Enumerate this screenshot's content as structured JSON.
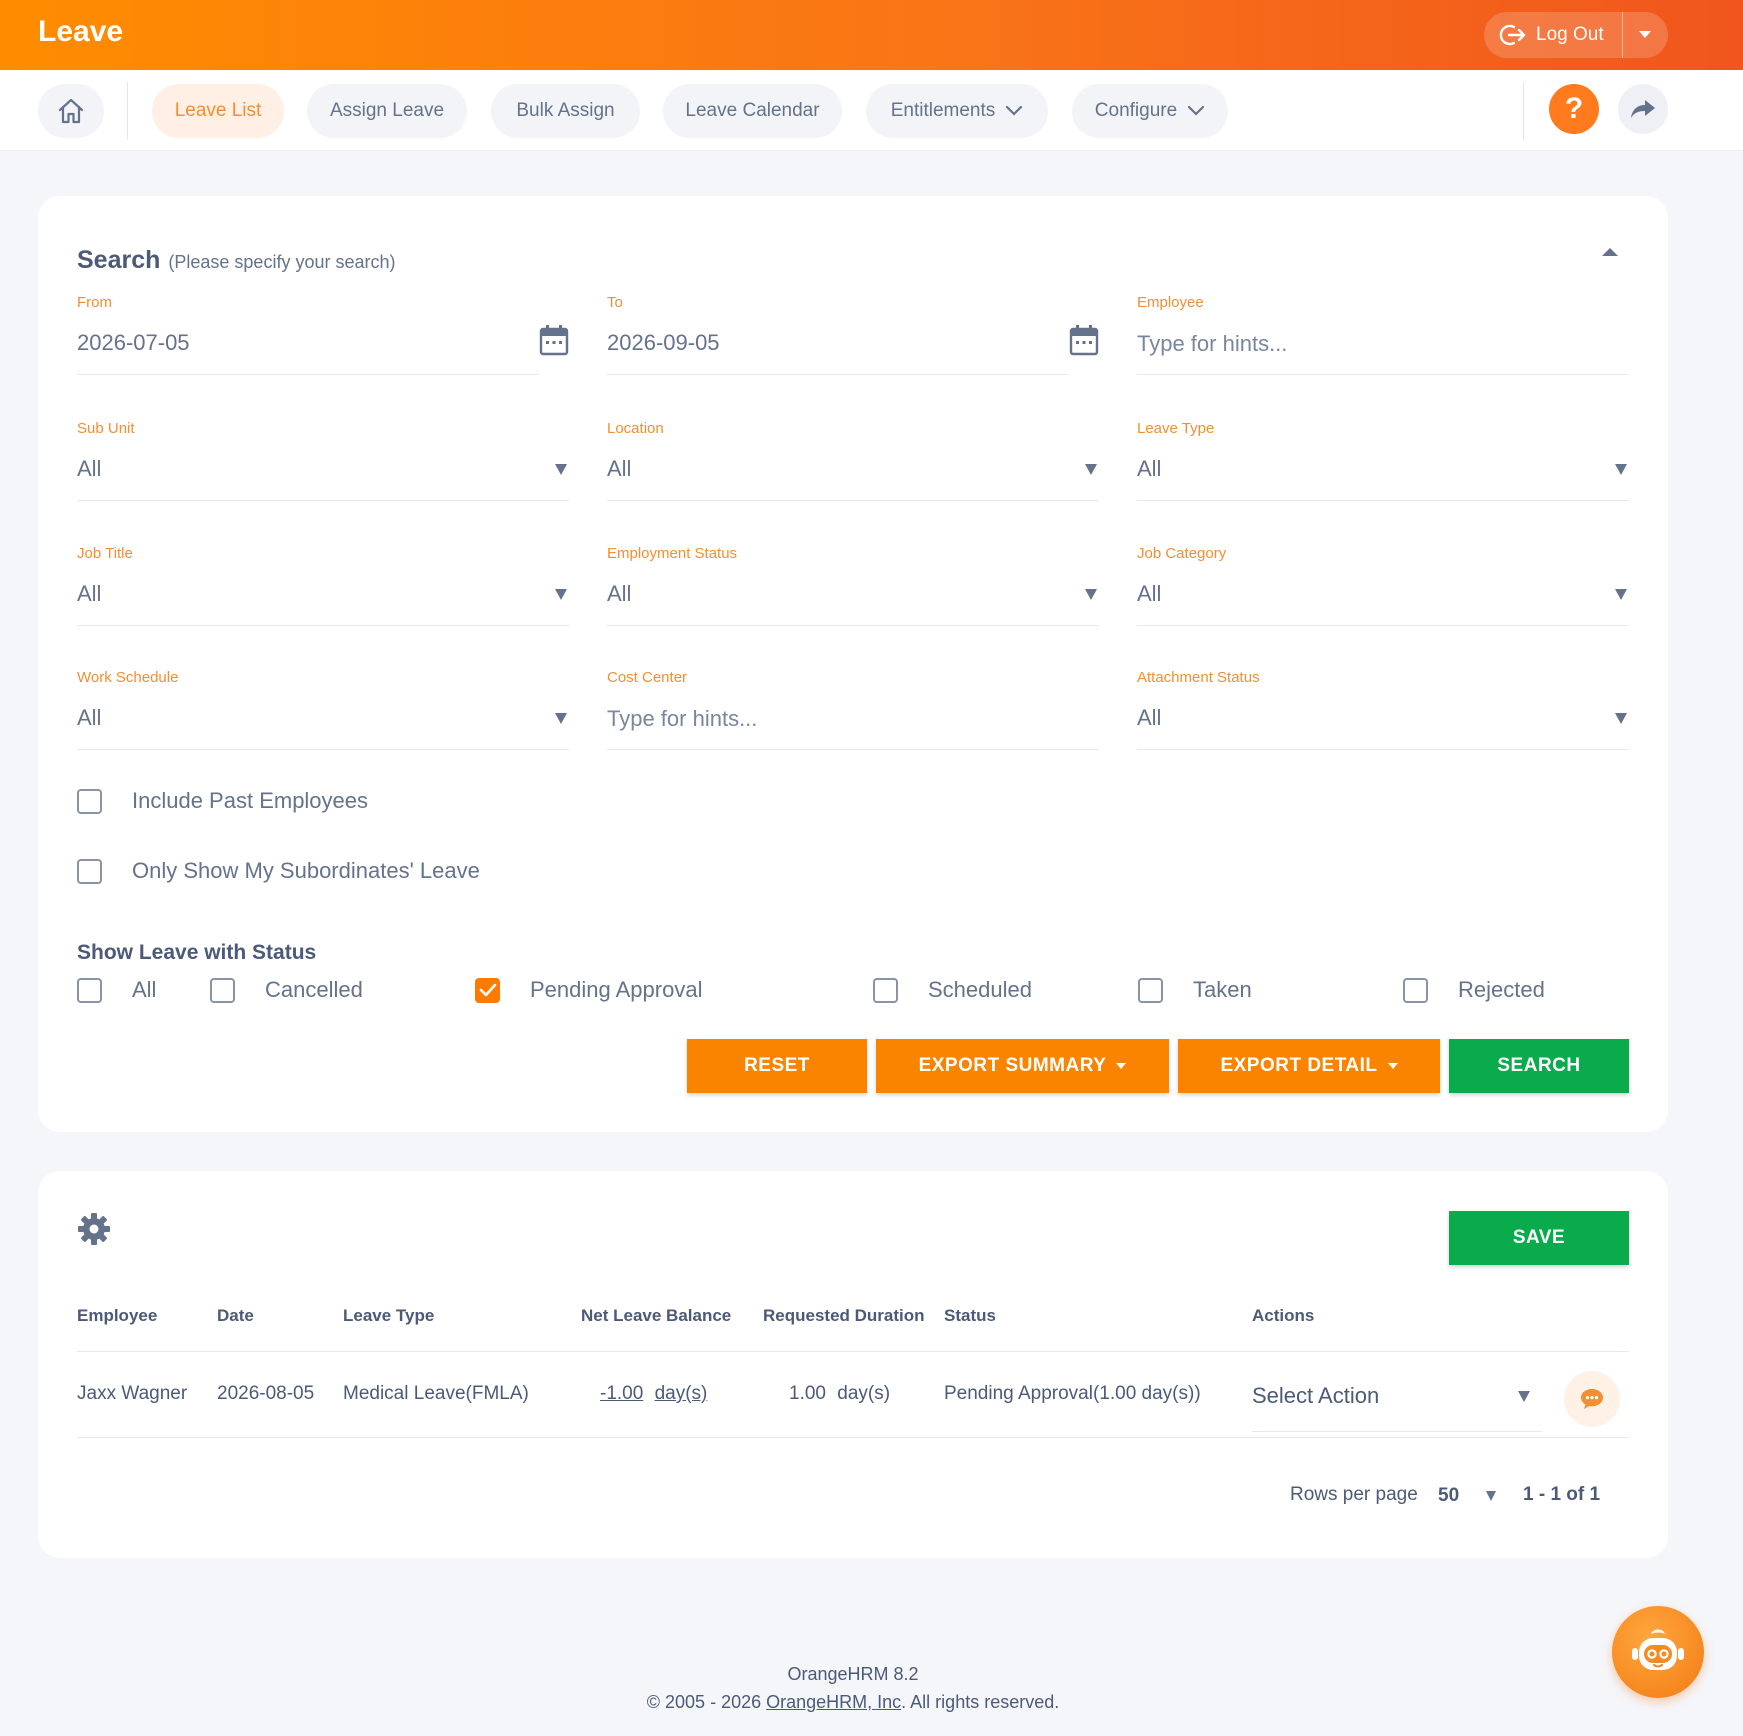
{
  "topbar": {
    "title": "Leave",
    "logout_label": "Log Out"
  },
  "nav": {
    "items": [
      {
        "label": "Leave List",
        "active": true
      },
      {
        "label": "Assign Leave"
      },
      {
        "label": "Bulk Assign"
      },
      {
        "label": "Leave Calendar"
      },
      {
        "label": "Entitlements",
        "dropdown": true
      },
      {
        "label": "Configure",
        "dropdown": true
      }
    ],
    "help_symbol": "?"
  },
  "search": {
    "title": "Search",
    "subtitle": "(Please specify your search)",
    "fields": {
      "from": {
        "label": "From",
        "value": "2026-07-05"
      },
      "to": {
        "label": "To",
        "value": "2026-09-05"
      },
      "employee": {
        "label": "Employee",
        "placeholder": "Type for hints..."
      },
      "sub_unit": {
        "label": "Sub Unit",
        "value": "All"
      },
      "location": {
        "label": "Location",
        "value": "All"
      },
      "leave_type": {
        "label": "Leave Type",
        "value": "All"
      },
      "job_title": {
        "label": "Job Title",
        "value": "All"
      },
      "employment_status": {
        "label": "Employment Status",
        "value": "All"
      },
      "job_category": {
        "label": "Job Category",
        "value": "All"
      },
      "work_schedule": {
        "label": "Work Schedule",
        "value": "All"
      },
      "cost_center": {
        "label": "Cost Center",
        "placeholder": "Type for hints..."
      },
      "attachment_status": {
        "label": "Attachment Status",
        "value": "All"
      }
    },
    "include_past_label": "Include Past Employees",
    "only_subordinates_label": "Only Show My Subordinates' Leave",
    "status_heading": "Show Leave with Status",
    "statuses": [
      {
        "label": "All",
        "checked": false
      },
      {
        "label": "Cancelled",
        "checked": false
      },
      {
        "label": "Pending Approval",
        "checked": true
      },
      {
        "label": "Scheduled",
        "checked": false
      },
      {
        "label": "Taken",
        "checked": false
      },
      {
        "label": "Rejected",
        "checked": false
      }
    ],
    "buttons": {
      "reset": "RESET",
      "export_summary": "EXPORT SUMMARY",
      "export_detail": "EXPORT DETAIL",
      "search": "SEARCH"
    }
  },
  "results": {
    "save_label": "SAVE",
    "columns": [
      "Employee",
      "Date",
      "Leave Type",
      "Net Leave Balance",
      "Requested Duration",
      "Status",
      "Actions"
    ],
    "rows": [
      {
        "employee": "Jaxx Wagner",
        "date": "2026-08-05",
        "leave_type": "Medical Leave(FMLA)",
        "net_balance": "-1.00",
        "net_balance_unit": "day(s)",
        "requested": "1.00",
        "requested_unit": "day(s)",
        "status": "Pending Approval(1.00 day(s))",
        "action": "Select Action"
      }
    ],
    "rows_per_page_label": "Rows per page",
    "rows_per_page": "50",
    "range": "1 - 1 of 1"
  },
  "footer": {
    "version": "OrangeHRM 8.2",
    "copyright_prefix": "© 2005 - 2026 ",
    "company": "OrangeHRM, Inc",
    "copyright_suffix": ". All rights reserved."
  },
  "colors": {
    "brand_orange": "#ff7b1d",
    "accent_green": "#0aab4c",
    "label_orange": "#f28f33"
  },
  "icons": [
    "logout-icon",
    "home-icon",
    "help-icon",
    "share-icon",
    "calendar-icon",
    "gear-icon",
    "comment-icon",
    "assistant-bot-icon"
  ]
}
